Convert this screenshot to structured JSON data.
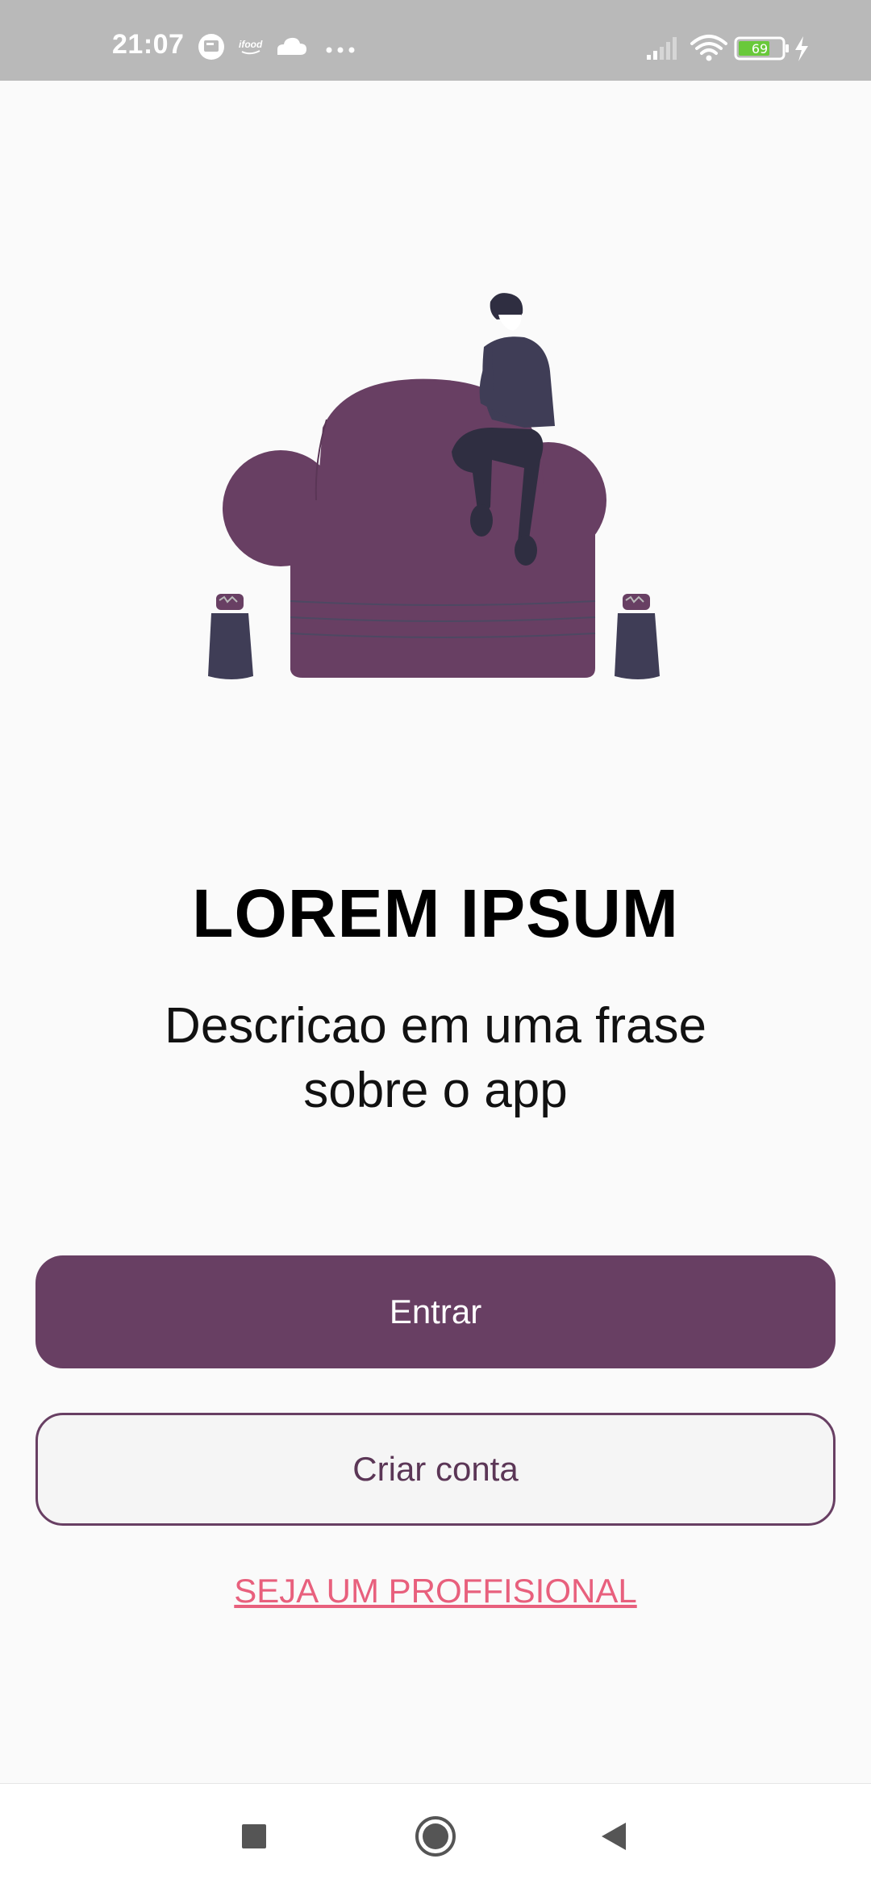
{
  "status_bar": {
    "time": "21:07",
    "left_icons": [
      "notification-app-icon",
      "ifood-icon",
      "cloud-icon",
      "more-dots-icon"
    ],
    "right_icons": [
      "signal-icon",
      "wifi-icon",
      "battery-icon",
      "charging-icon"
    ],
    "battery_level": "69",
    "app_badge": "ifood"
  },
  "hero": {
    "illustration": "man-sitting-on-armchair"
  },
  "content": {
    "title": "LOREM IPSUM",
    "description_line1": "Descricao em uma frase",
    "description_line2": "sobre o app"
  },
  "actions": {
    "login_label": "Entrar",
    "signup_label": "Criar conta",
    "professional_label": "SEJA UM PROFFISIONAL"
  },
  "nav_bar": {
    "buttons": [
      "recents-icon",
      "home-icon",
      "back-icon"
    ]
  },
  "colors": {
    "primary": "#683f63",
    "accent_link": "#e8607d",
    "status_bar_bg": "#b9b9b9",
    "background": "#fafafa",
    "figure_dark": "#3f3d56"
  }
}
